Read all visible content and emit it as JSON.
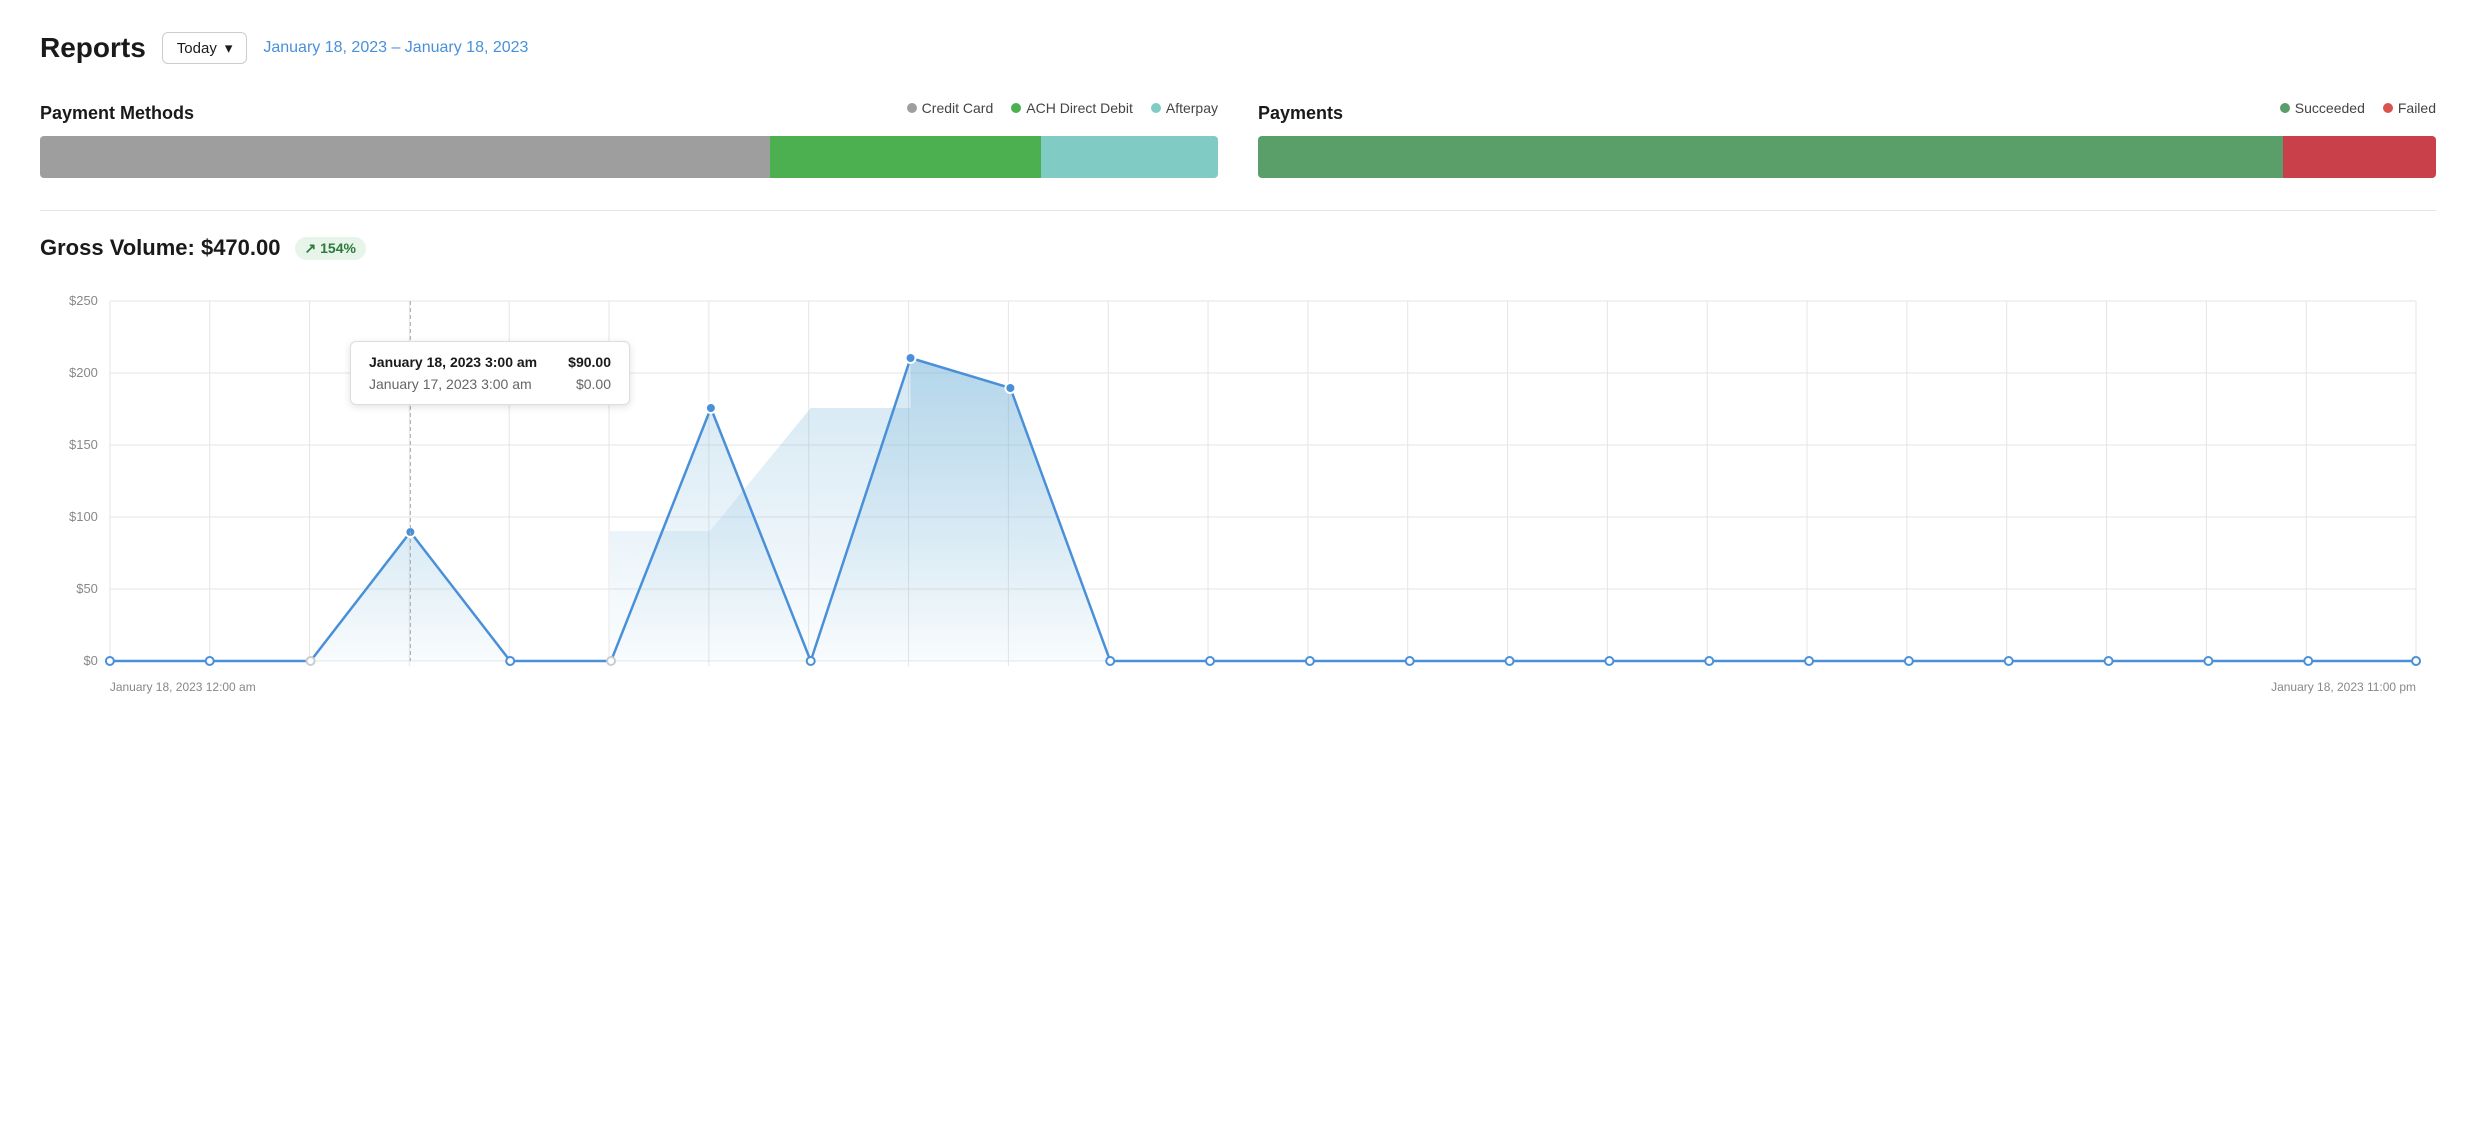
{
  "header": {
    "title": "Reports",
    "date_filter": "Today",
    "date_range": "January 18, 2023 – January 18, 2023"
  },
  "payment_methods": {
    "title": "Payment Methods",
    "legend": [
      {
        "id": "credit_card",
        "label": "Credit Card",
        "color": "#9e9e9e"
      },
      {
        "id": "ach",
        "label": "ACH Direct Debit",
        "color": "#4caf50"
      },
      {
        "id": "afterpay",
        "label": "Afterpay",
        "color": "#80cbc4"
      }
    ],
    "bar": [
      {
        "label": "Credit Card",
        "pct": 62,
        "color": "#9e9e9e"
      },
      {
        "label": "ACH Direct Debit",
        "pct": 23,
        "color": "#4caf50"
      },
      {
        "label": "Afterpay",
        "pct": 15,
        "color": "#80cbc4"
      }
    ]
  },
  "payments": {
    "title": "Payments",
    "legend": [
      {
        "id": "succeeded",
        "label": "Succeeded",
        "color": "#5a9e6a"
      },
      {
        "id": "failed",
        "label": "Failed",
        "color": "#d9534f"
      }
    ],
    "bar": [
      {
        "label": "Succeeded",
        "pct": 87,
        "color": "#5a9e6a"
      },
      {
        "label": "Failed",
        "pct": 13,
        "color": "#c9404a"
      }
    ]
  },
  "gross_volume": {
    "label": "Gross Volume: $470.00",
    "badge": "↗ 154%"
  },
  "chart": {
    "y_labels": [
      "$250",
      "$200",
      "$150",
      "$100",
      "$50",
      "$0"
    ],
    "x_label_start": "January 18, 2023 12:00 am",
    "x_label_end": "January 18, 2023 11:00 pm",
    "tooltip": {
      "row1_label": "January 18, 2023 3:00 am",
      "row1_value": "$90.00",
      "row2_label": "January 17, 2023 3:00 am",
      "row2_value": "$0.00"
    }
  }
}
